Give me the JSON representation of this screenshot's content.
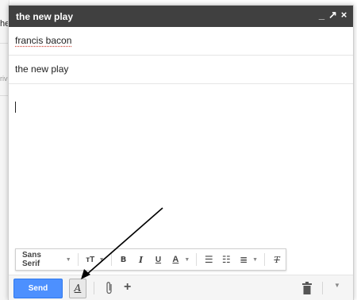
{
  "background": {
    "fragments": [
      "he",
      "riv"
    ]
  },
  "window": {
    "title": "the new play",
    "controls": {
      "minimize": "_",
      "popout": "↗",
      "close": "×"
    }
  },
  "compose": {
    "to": "francis bacon",
    "subject": "the new play",
    "body": ""
  },
  "format_toolbar": {
    "font": "Sans Serif",
    "font_dropdown": "▼",
    "size": "тT",
    "bold": "B",
    "italic": "I",
    "underline": "U",
    "text_color": "A",
    "numbered_list": "☰",
    "bulleted_list": "☷",
    "align": "≣",
    "remove_formatting": "T"
  },
  "actions": {
    "send_label": "Send",
    "formatting_toggle": "A",
    "plus": "+",
    "more": "▼"
  },
  "colors": {
    "titlebar": "#404040",
    "send": "#4d90fe",
    "accent_red_underline": "#d04437"
  }
}
